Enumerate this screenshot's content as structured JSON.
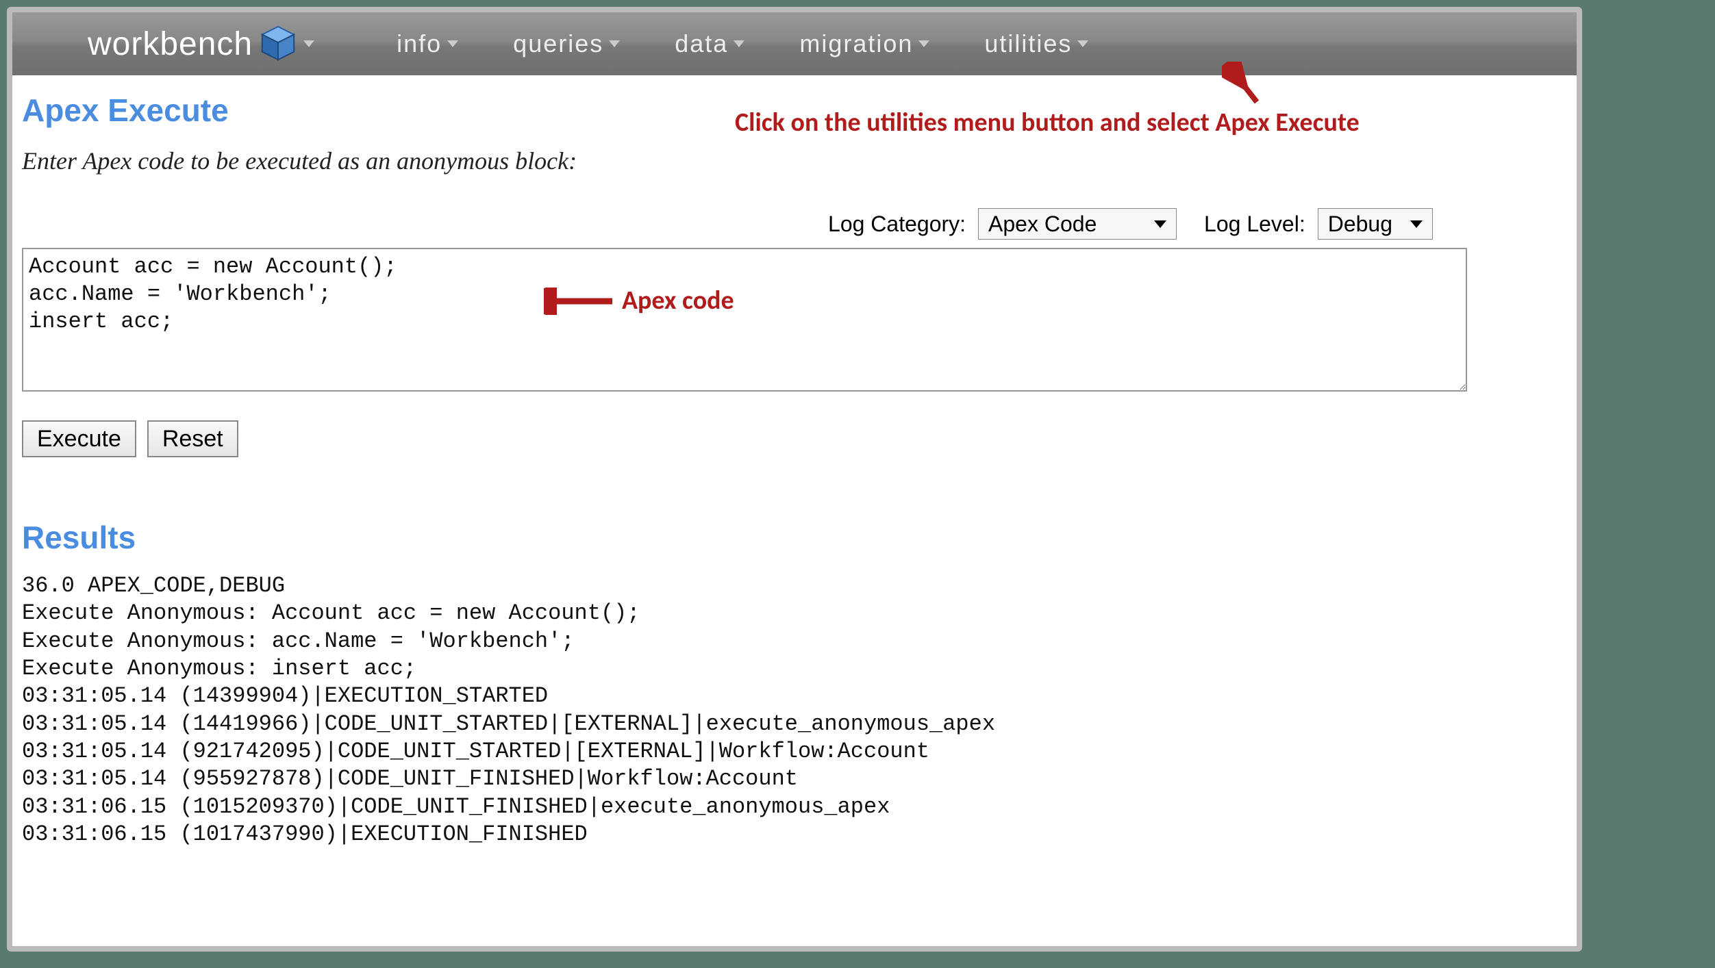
{
  "brand": "workbench",
  "nav": {
    "info": "info",
    "queries": "queries",
    "data": "data",
    "migration": "migration",
    "utilities": "utilities"
  },
  "page_title": "Apex Execute",
  "instruction": "Enter Apex code to be executed as an anonymous block:",
  "log_category_label": "Log Category:",
  "log_category_value": "Apex Code",
  "log_level_label": "Log Level:",
  "log_level_value": "Debug",
  "code": "Account acc = new Account();\nacc.Name = 'Workbench';\ninsert acc;",
  "buttons": {
    "execute": "Execute",
    "reset": "Reset"
  },
  "results_title": "Results",
  "results_log": "36.0 APEX_CODE,DEBUG\nExecute Anonymous: Account acc = new Account();\nExecute Anonymous: acc.Name = 'Workbench';\nExecute Anonymous: insert acc;\n03:31:05.14 (14399904)|EXECUTION_STARTED\n03:31:05.14 (14419966)|CODE_UNIT_STARTED|[EXTERNAL]|execute_anonymous_apex\n03:31:05.14 (921742095)|CODE_UNIT_STARTED|[EXTERNAL]|Workflow:Account\n03:31:05.14 (955927878)|CODE_UNIT_FINISHED|Workflow:Account\n03:31:06.15 (1015209370)|CODE_UNIT_FINISHED|execute_anonymous_apex\n03:31:06.15 (1017437990)|EXECUTION_FINISHED",
  "annotations": {
    "utilities_hint": "Click on the utilities menu button and select Apex Execute",
    "code_hint": "Apex code"
  }
}
